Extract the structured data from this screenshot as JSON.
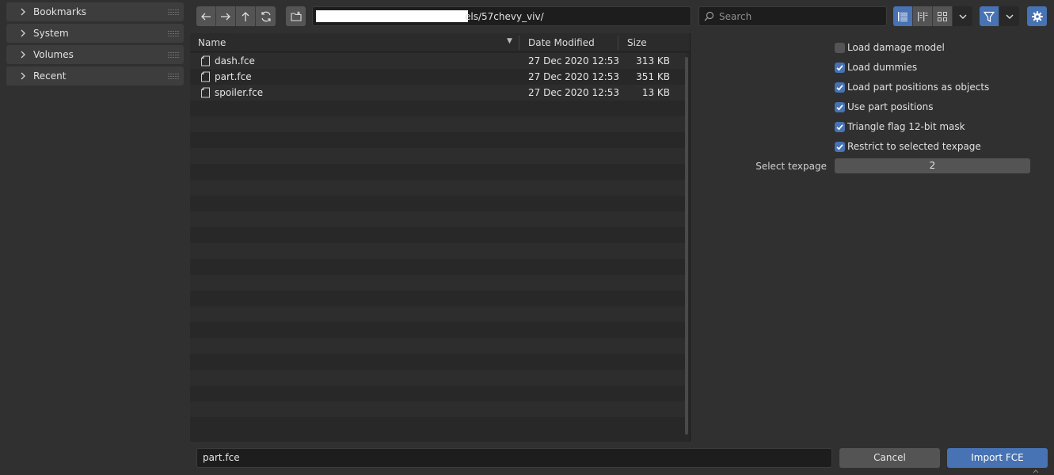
{
  "sidebar": {
    "panels": [
      {
        "label": "Bookmarks"
      },
      {
        "label": "System"
      },
      {
        "label": "Volumes"
      },
      {
        "label": "Recent"
      }
    ]
  },
  "toolbar": {
    "path_visible": "els/57chevy_viv/",
    "search_placeholder": "Search",
    "icons": [
      "arrow-left-icon",
      "arrow-right-icon",
      "parent-directory-icon",
      "refresh-icon",
      "new-folder-icon",
      "vertical-list-icon",
      "horizontal-list-icon",
      "thumbnails-icon",
      "chevron-down-icon",
      "filter-icon",
      "chevron-down-icon",
      "gear-icon"
    ]
  },
  "file_list": {
    "columns": {
      "name": "Name",
      "date": "Date Modified",
      "size": "Size"
    },
    "files": [
      {
        "name": "dash.fce",
        "date": "27 Dec 2020 12:53",
        "size": "313 KB"
      },
      {
        "name": "part.fce",
        "date": "27 Dec 2020 12:53",
        "size": "351 KB"
      },
      {
        "name": "spoiler.fce",
        "date": "27 Dec 2020 12:53",
        "size": "13 KB"
      }
    ]
  },
  "options": {
    "checkboxes": [
      {
        "label": "Load damage model",
        "checked": false
      },
      {
        "label": "Load dummies",
        "checked": true
      },
      {
        "label": "Load part positions as objects",
        "checked": true
      },
      {
        "label": "Use part positions",
        "checked": true
      },
      {
        "label": "Triangle flag 12-bit mask",
        "checked": true
      },
      {
        "label": "Restrict to selected texpage",
        "checked": true
      }
    ],
    "texpage_label": "Select texpage",
    "texpage_value": "2"
  },
  "bottom": {
    "filename": "part.fce",
    "cancel_label": "Cancel",
    "import_label": "Import FCE"
  },
  "colors": {
    "accent": "#4772b3",
    "background": "#303030",
    "list_background": "#282828"
  }
}
